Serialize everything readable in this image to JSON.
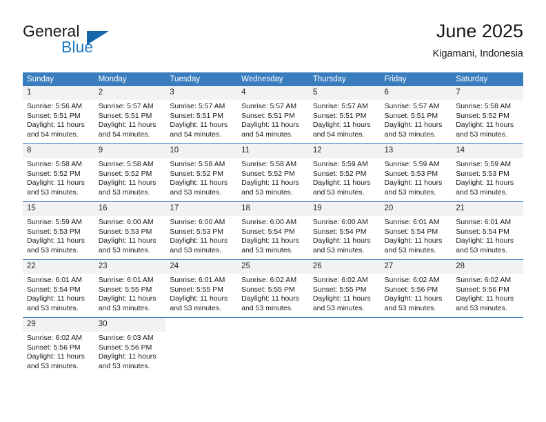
{
  "brand": {
    "name_part1": "General",
    "name_part2": "Blue",
    "flag_icon": "flag-triangle-icon",
    "colors": {
      "blue": "#1f7ac4",
      "flag": "#1566ad",
      "dark": "#1a1a1a"
    }
  },
  "header": {
    "title": "June 2025",
    "location": "Kigamani, Indonesia"
  },
  "calendar": {
    "accent_color": "#3a7dbf",
    "daynum_bg": "#f2f2f2",
    "weekday_headers": [
      "Sunday",
      "Monday",
      "Tuesday",
      "Wednesday",
      "Thursday",
      "Friday",
      "Saturday"
    ],
    "weeks": [
      [
        {
          "day": "1",
          "sunrise": "Sunrise: 5:56 AM",
          "sunset": "Sunset: 5:51 PM",
          "daylight": "Daylight: 11 hours and 54 minutes."
        },
        {
          "day": "2",
          "sunrise": "Sunrise: 5:57 AM",
          "sunset": "Sunset: 5:51 PM",
          "daylight": "Daylight: 11 hours and 54 minutes."
        },
        {
          "day": "3",
          "sunrise": "Sunrise: 5:57 AM",
          "sunset": "Sunset: 5:51 PM",
          "daylight": "Daylight: 11 hours and 54 minutes."
        },
        {
          "day": "4",
          "sunrise": "Sunrise: 5:57 AM",
          "sunset": "Sunset: 5:51 PM",
          "daylight": "Daylight: 11 hours and 54 minutes."
        },
        {
          "day": "5",
          "sunrise": "Sunrise: 5:57 AM",
          "sunset": "Sunset: 5:51 PM",
          "daylight": "Daylight: 11 hours and 54 minutes."
        },
        {
          "day": "6",
          "sunrise": "Sunrise: 5:57 AM",
          "sunset": "Sunset: 5:51 PM",
          "daylight": "Daylight: 11 hours and 53 minutes."
        },
        {
          "day": "7",
          "sunrise": "Sunrise: 5:58 AM",
          "sunset": "Sunset: 5:52 PM",
          "daylight": "Daylight: 11 hours and 53 minutes."
        }
      ],
      [
        {
          "day": "8",
          "sunrise": "Sunrise: 5:58 AM",
          "sunset": "Sunset: 5:52 PM",
          "daylight": "Daylight: 11 hours and 53 minutes."
        },
        {
          "day": "9",
          "sunrise": "Sunrise: 5:58 AM",
          "sunset": "Sunset: 5:52 PM",
          "daylight": "Daylight: 11 hours and 53 minutes."
        },
        {
          "day": "10",
          "sunrise": "Sunrise: 5:58 AM",
          "sunset": "Sunset: 5:52 PM",
          "daylight": "Daylight: 11 hours and 53 minutes."
        },
        {
          "day": "11",
          "sunrise": "Sunrise: 5:58 AM",
          "sunset": "Sunset: 5:52 PM",
          "daylight": "Daylight: 11 hours and 53 minutes."
        },
        {
          "day": "12",
          "sunrise": "Sunrise: 5:59 AM",
          "sunset": "Sunset: 5:52 PM",
          "daylight": "Daylight: 11 hours and 53 minutes."
        },
        {
          "day": "13",
          "sunrise": "Sunrise: 5:59 AM",
          "sunset": "Sunset: 5:53 PM",
          "daylight": "Daylight: 11 hours and 53 minutes."
        },
        {
          "day": "14",
          "sunrise": "Sunrise: 5:59 AM",
          "sunset": "Sunset: 5:53 PM",
          "daylight": "Daylight: 11 hours and 53 minutes."
        }
      ],
      [
        {
          "day": "15",
          "sunrise": "Sunrise: 5:59 AM",
          "sunset": "Sunset: 5:53 PM",
          "daylight": "Daylight: 11 hours and 53 minutes."
        },
        {
          "day": "16",
          "sunrise": "Sunrise: 6:00 AM",
          "sunset": "Sunset: 5:53 PM",
          "daylight": "Daylight: 11 hours and 53 minutes."
        },
        {
          "day": "17",
          "sunrise": "Sunrise: 6:00 AM",
          "sunset": "Sunset: 5:53 PM",
          "daylight": "Daylight: 11 hours and 53 minutes."
        },
        {
          "day": "18",
          "sunrise": "Sunrise: 6:00 AM",
          "sunset": "Sunset: 5:54 PM",
          "daylight": "Daylight: 11 hours and 53 minutes."
        },
        {
          "day": "19",
          "sunrise": "Sunrise: 6:00 AM",
          "sunset": "Sunset: 5:54 PM",
          "daylight": "Daylight: 11 hours and 53 minutes."
        },
        {
          "day": "20",
          "sunrise": "Sunrise: 6:01 AM",
          "sunset": "Sunset: 5:54 PM",
          "daylight": "Daylight: 11 hours and 53 minutes."
        },
        {
          "day": "21",
          "sunrise": "Sunrise: 6:01 AM",
          "sunset": "Sunset: 5:54 PM",
          "daylight": "Daylight: 11 hours and 53 minutes."
        }
      ],
      [
        {
          "day": "22",
          "sunrise": "Sunrise: 6:01 AM",
          "sunset": "Sunset: 5:54 PM",
          "daylight": "Daylight: 11 hours and 53 minutes."
        },
        {
          "day": "23",
          "sunrise": "Sunrise: 6:01 AM",
          "sunset": "Sunset: 5:55 PM",
          "daylight": "Daylight: 11 hours and 53 minutes."
        },
        {
          "day": "24",
          "sunrise": "Sunrise: 6:01 AM",
          "sunset": "Sunset: 5:55 PM",
          "daylight": "Daylight: 11 hours and 53 minutes."
        },
        {
          "day": "25",
          "sunrise": "Sunrise: 6:02 AM",
          "sunset": "Sunset: 5:55 PM",
          "daylight": "Daylight: 11 hours and 53 minutes."
        },
        {
          "day": "26",
          "sunrise": "Sunrise: 6:02 AM",
          "sunset": "Sunset: 5:55 PM",
          "daylight": "Daylight: 11 hours and 53 minutes."
        },
        {
          "day": "27",
          "sunrise": "Sunrise: 6:02 AM",
          "sunset": "Sunset: 5:56 PM",
          "daylight": "Daylight: 11 hours and 53 minutes."
        },
        {
          "day": "28",
          "sunrise": "Sunrise: 6:02 AM",
          "sunset": "Sunset: 5:56 PM",
          "daylight": "Daylight: 11 hours and 53 minutes."
        }
      ],
      [
        {
          "day": "29",
          "sunrise": "Sunrise: 6:02 AM",
          "sunset": "Sunset: 5:56 PM",
          "daylight": "Daylight: 11 hours and 53 minutes."
        },
        {
          "day": "30",
          "sunrise": "Sunrise: 6:03 AM",
          "sunset": "Sunset: 5:56 PM",
          "daylight": "Daylight: 11 hours and 53 minutes."
        },
        {
          "day": "",
          "sunrise": "",
          "sunset": "",
          "daylight": ""
        },
        {
          "day": "",
          "sunrise": "",
          "sunset": "",
          "daylight": ""
        },
        {
          "day": "",
          "sunrise": "",
          "sunset": "",
          "daylight": ""
        },
        {
          "day": "",
          "sunrise": "",
          "sunset": "",
          "daylight": ""
        },
        {
          "day": "",
          "sunrise": "",
          "sunset": "",
          "daylight": ""
        }
      ]
    ]
  }
}
